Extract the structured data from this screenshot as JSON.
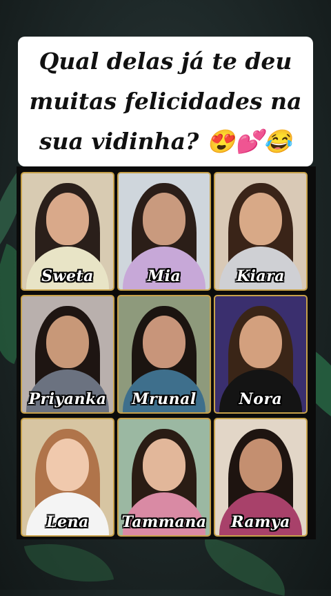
{
  "title": {
    "lines": [
      "Qual delas já te deu",
      "muitas felicidades na",
      "sua vidinha? 😍💕😂"
    ]
  },
  "cards": [
    {
      "name": "Sweta",
      "bg": "#d8cbb2",
      "hair": "#2a1f1a",
      "skin": "#d9a98a",
      "top": "#e8e4c6"
    },
    {
      "name": "Mia",
      "bg": "#cfd6dc",
      "hair": "#2b1e18",
      "skin": "#c99a7e",
      "top": "#c7a8d8"
    },
    {
      "name": "Kiara",
      "bg": "#d9c9b6",
      "hair": "#3a2418",
      "skin": "#d8a987",
      "top": "#cfd0d4"
    },
    {
      "name": "Priyanka",
      "bg": "#b9b0ad",
      "hair": "#1e1512",
      "skin": "#c89878",
      "top": "#6b7280"
    },
    {
      "name": "Mrunal",
      "bg": "#8e9a7c",
      "hair": "#1b1410",
      "skin": "#c8957a",
      "top": "#3e6f8c"
    },
    {
      "name": "Nora",
      "bg": "#3a2f6e",
      "hair": "#3a2517",
      "skin": "#d3a07e",
      "top": "#141414"
    },
    {
      "name": "Lena",
      "bg": "#d7c5a2",
      "hair": "#b0744a",
      "skin": "#f0c9ad",
      "top": "#f4f4f4"
    },
    {
      "name": "Tammana",
      "bg": "#9bb8a2",
      "hair": "#2a1c14",
      "skin": "#e2b79a",
      "top": "#d98aa4"
    },
    {
      "name": "Ramya",
      "bg": "#e2d6c7",
      "hair": "#1e1410",
      "skin": "#c48f70",
      "top": "#a8416a"
    }
  ]
}
